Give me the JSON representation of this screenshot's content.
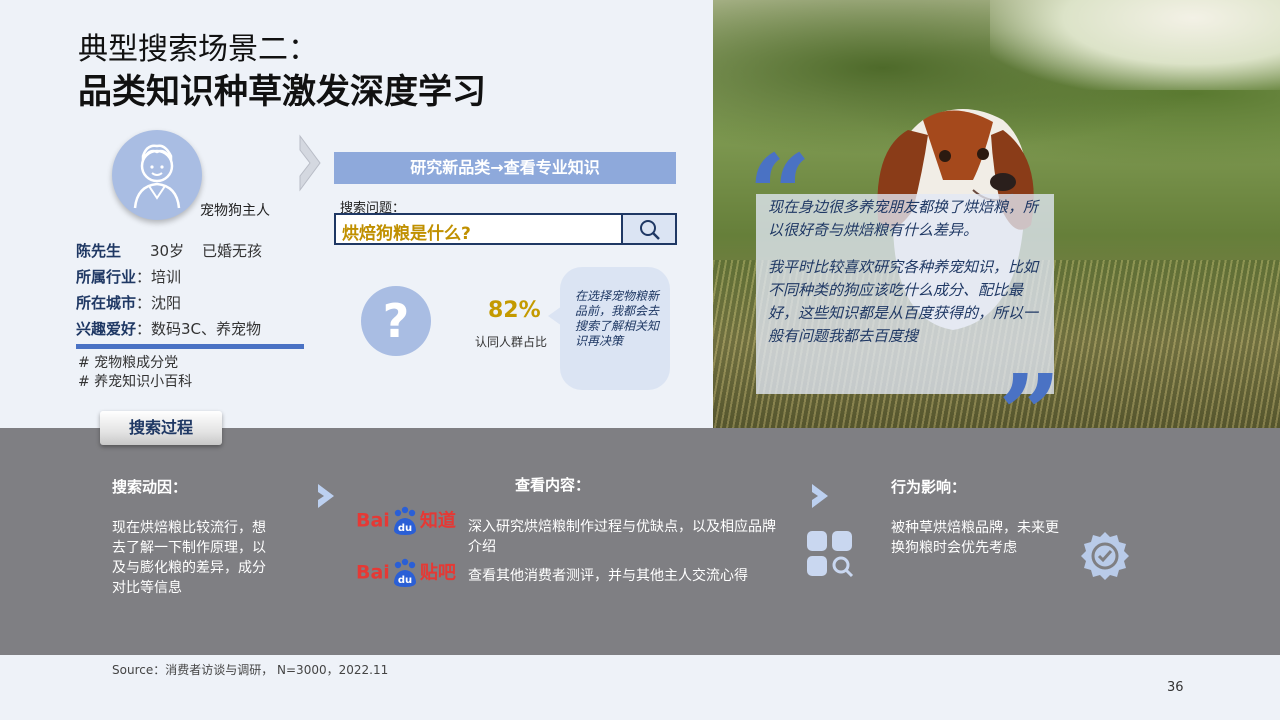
{
  "title": {
    "line1": "典型搜索场景二：",
    "line2": "品类知识种草激发深度学习"
  },
  "persona": {
    "role": "宠物狗主人",
    "name_label": "陈先生",
    "age": "30岁",
    "marital": "已婚无孩",
    "industry_label": "所属行业",
    "industry_value": "：培训",
    "city_label": "所在城市",
    "city_value": "：沈阳",
    "hobby_label": "兴趣爱好",
    "hobby_value": "：数码3C、养宠物",
    "tags": [
      "# 宠物粮成分党",
      "# 养宠知识小百科"
    ]
  },
  "research": {
    "banner": "研究新品类→查看专业知识",
    "search_label": "搜索问题：",
    "search_query": "烘焙狗粮是什么?"
  },
  "stat": {
    "value": "82%",
    "label": "认同人群占比",
    "bubble": "在选择宠物粮新品前，我都会去搜索了解相关知识再决策"
  },
  "quote": {
    "p1": "现在身边很多养宠朋友都换了烘焙粮，所以很好奇与烘焙粮有什么差异。",
    "p2": "我平时比较喜欢研究各种养宠知识，比如不同种类的狗应该吃什么成分、配比最好，这些知识都是从百度获得的，所以一般有问题我都去百度搜"
  },
  "process": {
    "tab": "搜索过程",
    "motive_head": "搜索动因：",
    "motive_body": "现在烘焙粮比较流行，想去了解一下制作原理，以及与膨化粮的差异，成分对比等信息",
    "content_head": "查看内容：",
    "baidu_zhidao_brand": "Bai",
    "baidu_zhidao_du": "du",
    "baidu_zhidao_sub": "知道",
    "baidu_zhidao_text": "深入研究烘焙粮制作过程与优缺点，以及相应品牌介绍",
    "baidu_tieba_brand": "Bai",
    "baidu_tieba_du": "du",
    "baidu_tieba_sub": "贴吧",
    "baidu_tieba_text": "查看其他消费者测评，并与其他主人交流心得",
    "impact_head": "行为影响：",
    "impact_body": "被种草烘焙粮品牌，未来更换狗粮时会优先考虑"
  },
  "footer": {
    "source": "Source：消费者访谈与调研，  N=3000，2022.11",
    "page": "36"
  },
  "colors": {
    "accent_blue": "#4a72c4",
    "navy": "#1f3864",
    "gold": "#c49a00",
    "band_grey": "#7f7f83",
    "baidu_red": "#e53935",
    "baidu_blue": "#2a5fd6"
  }
}
